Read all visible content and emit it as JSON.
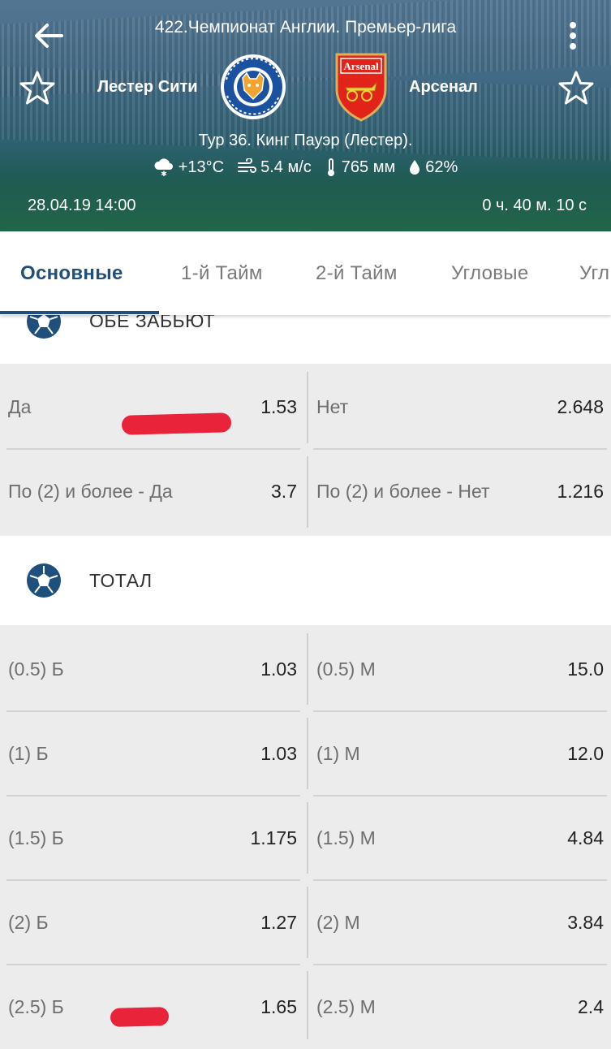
{
  "header": {
    "league": "422.Чемпионат Англии. Премьер-лига",
    "home_team": "Лестер Сити",
    "away_team": "Арсенал",
    "venue": "Тур 36. Кинг Пауэр (Лестер).",
    "weather": {
      "temperature": "+13°C",
      "wind": "5.4 м/с",
      "pressure": "765 мм",
      "humidity": "62%"
    },
    "datetime": "28.04.19 14:00",
    "countdown": "0 ч. 40 м. 10 с",
    "home_crest_icon": "leicester-city-crest-icon",
    "away_crest_icon": "arsenal-crest-icon",
    "away_crest_text": "Arsenal"
  },
  "tabs": [
    "Основные",
    "1-й  Тайм",
    "2-й  Тайм",
    "Угловые",
    "Угл"
  ],
  "active_tab": 0,
  "sections": {
    "both_score": {
      "title": "ОБЕ ЗАБЬЮТ",
      "rows": [
        {
          "left_label": "Да",
          "left_odd": "1.53",
          "right_label": "Нет",
          "right_odd": "2.648"
        },
        {
          "left_label": "По (2) и более - Да",
          "left_odd": "3.7",
          "right_label": "По (2) и более - Нет",
          "right_odd": "1.216"
        }
      ]
    },
    "total": {
      "title": "ТОТАЛ",
      "rows": [
        {
          "left_label": "(0.5) Б",
          "left_odd": "1.03",
          "right_label": "(0.5) М",
          "right_odd": "15.0"
        },
        {
          "left_label": "(1) Б",
          "left_odd": "1.03",
          "right_label": "(1) М",
          "right_odd": "12.0"
        },
        {
          "left_label": "(1.5) Б",
          "left_odd": "1.175",
          "right_label": "(1.5) М",
          "right_odd": "4.84"
        },
        {
          "left_label": "(2) Б",
          "left_odd": "1.27",
          "right_label": "(2) М",
          "right_odd": "3.84"
        },
        {
          "left_label": "(2.5) Б",
          "left_odd": "1.65",
          "right_label": "(2.5) М",
          "right_odd": "2.4"
        }
      ]
    }
  },
  "colors": {
    "accent": "#1f4f7c",
    "annotation_red": "#e8233a",
    "background": "#ececec"
  }
}
